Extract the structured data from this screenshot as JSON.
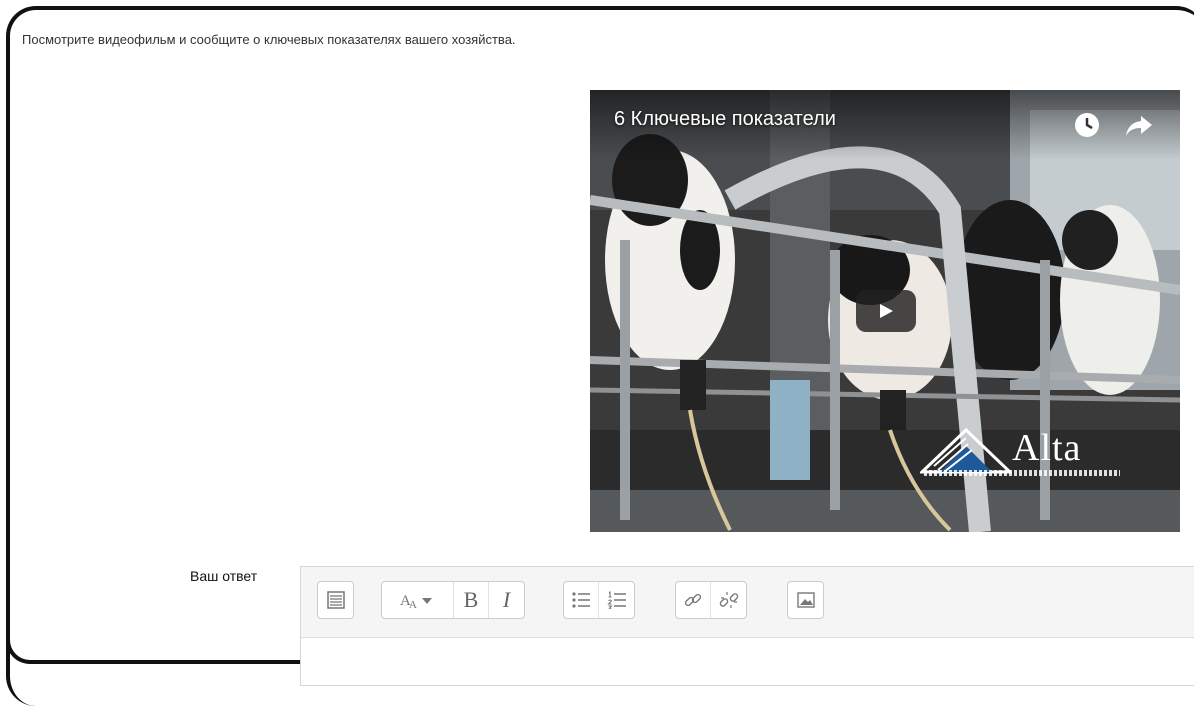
{
  "question": {
    "prompt": "Посмотрите видеофильм и сообщите о ключевых показателях вашего хозяйства."
  },
  "video": {
    "title": "6 Ключевые показатели",
    "icons": [
      "watch-later-icon",
      "share-icon",
      "play-icon"
    ],
    "logo_text": "Alta"
  },
  "answer": {
    "label": "Ваш ответ"
  },
  "toolbar": {
    "buttons": [
      "toolbar-toggle",
      "font-style",
      "bold",
      "italic",
      "unordered-list",
      "ordered-list",
      "link",
      "unlink",
      "image"
    ],
    "bold_label": "B",
    "italic_label": "I"
  },
  "colors": {
    "frame": "#111111",
    "toolbar_bg": "#f5f5f5",
    "icon": "#666666"
  }
}
